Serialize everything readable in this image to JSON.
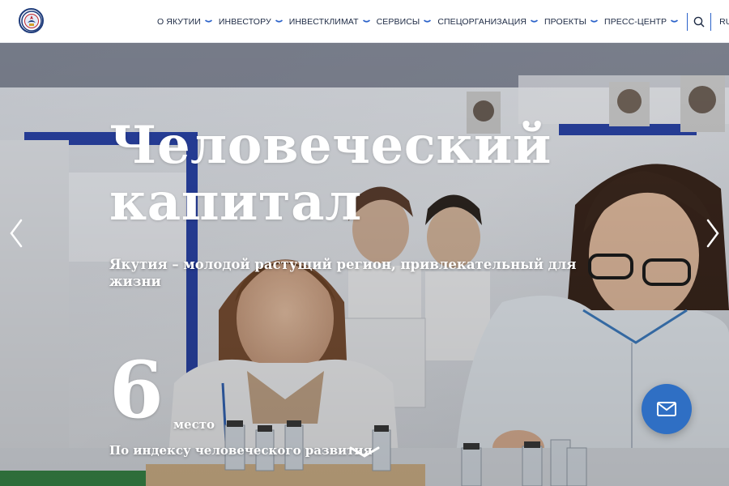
{
  "header": {
    "logo_icon": "yakutia-emblem-icon",
    "nav": [
      {
        "label": "О ЯКУТИИ"
      },
      {
        "label": "ИНВЕСТОРУ"
      },
      {
        "label": "ИНВЕСТКЛИМАТ"
      },
      {
        "label": "СЕРВИСЫ"
      },
      {
        "label": "СПЕЦОРГАНИЗАЦИЯ"
      },
      {
        "label": "ПРОЕКТЫ"
      },
      {
        "label": "ПРЕСС-ЦЕНТР"
      }
    ],
    "search_icon": "search-icon",
    "lang": "RU",
    "menu_icon": "hamburger-menu-icon",
    "accent": "#2b62c9"
  },
  "hero": {
    "title_line1": "Человеческий",
    "title_line2": "капитал",
    "subtitle": "Якутия – молодой растущий регион, привлекательный для жизни",
    "stat_value": "6",
    "stat_unit": "место",
    "stat_desc": "По индексу человеческого развития",
    "prev_icon": "chevron-left-icon",
    "next_icon": "chevron-right-icon",
    "scroll_icon": "chevron-down-icon"
  },
  "mail_button": {
    "icon": "envelope-icon",
    "color": "#2f6fc4"
  }
}
